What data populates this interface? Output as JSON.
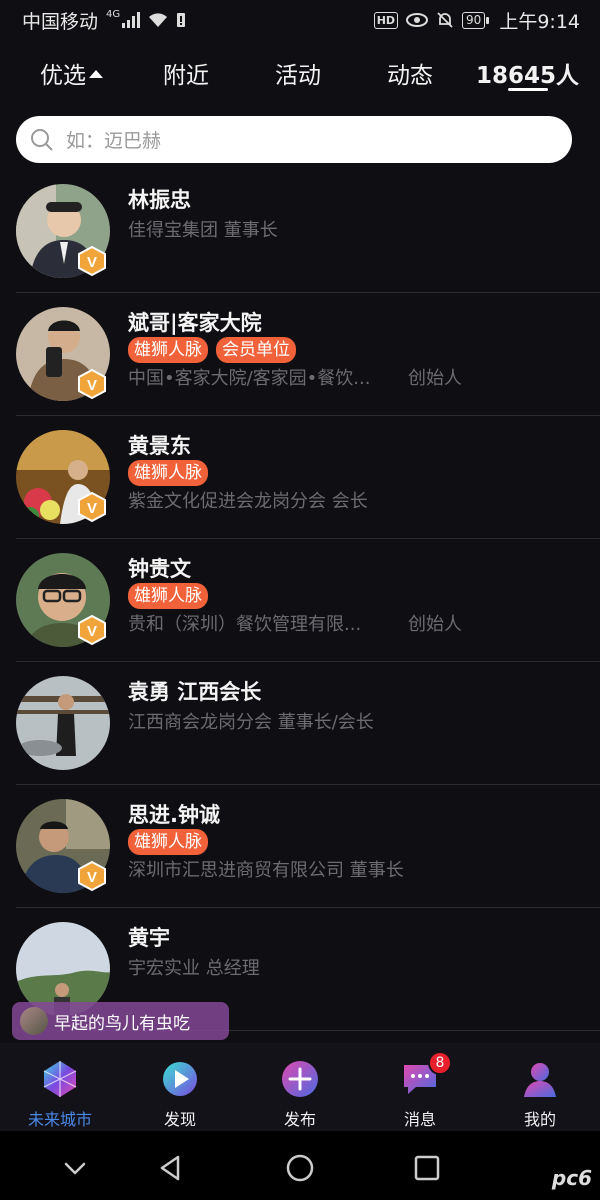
{
  "status": {
    "carrier": "中国移动",
    "network": "4G",
    "hd": "HD",
    "battery": "90",
    "time": "上午9:14"
  },
  "topnav": {
    "tabs": [
      {
        "label": "优选"
      },
      {
        "label": "附近"
      },
      {
        "label": "活动"
      },
      {
        "label": "动态"
      },
      {
        "label": "18645人"
      }
    ]
  },
  "search": {
    "placeholder": "如：迈巴赫"
  },
  "list": [
    {
      "name": "林振忠",
      "tags": [],
      "desc": "佳得宝集团  董事长",
      "role": "",
      "verified": true
    },
    {
      "name": "斌哥|客家大院",
      "tags": [
        "雄狮人脉",
        "会员单位"
      ],
      "desc": "中国•客家大院/客家园•餐饮...",
      "role": "创始人",
      "verified": true
    },
    {
      "name": "黄景东",
      "tags": [
        "雄狮人脉"
      ],
      "desc": "紫金文化促进会龙岗分会  会长",
      "role": "",
      "verified": true
    },
    {
      "name": "钟贵文",
      "tags": [
        "雄狮人脉"
      ],
      "desc": "贵和（深圳）餐饮管理有限...",
      "role": "创始人",
      "verified": true
    },
    {
      "name": "袁勇 江西会长",
      "tags": [],
      "desc": "江西商会龙岗分会  董事长/会长",
      "role": "",
      "verified": false
    },
    {
      "name": "思进.钟诚",
      "tags": [
        "雄狮人脉"
      ],
      "desc": "深圳市汇思进商贸有限公司  董事长",
      "role": "",
      "verified": true
    },
    {
      "name": "黄宇",
      "tags": [],
      "desc": "宇宏实业  总经理",
      "role": "",
      "verified": false
    }
  ],
  "bubble": {
    "text": "早起的鸟儿有虫吃"
  },
  "tabbar": {
    "items": [
      {
        "label": "未来城市"
      },
      {
        "label": "发现"
      },
      {
        "label": "发布"
      },
      {
        "label": "消息",
        "badge": "8"
      },
      {
        "label": "我的"
      }
    ]
  },
  "colors": {
    "accent": "#4a88e8",
    "tag": "#f2623a",
    "badge": "#e8202b",
    "background": "#0f0e12"
  },
  "watermark": "pc6"
}
